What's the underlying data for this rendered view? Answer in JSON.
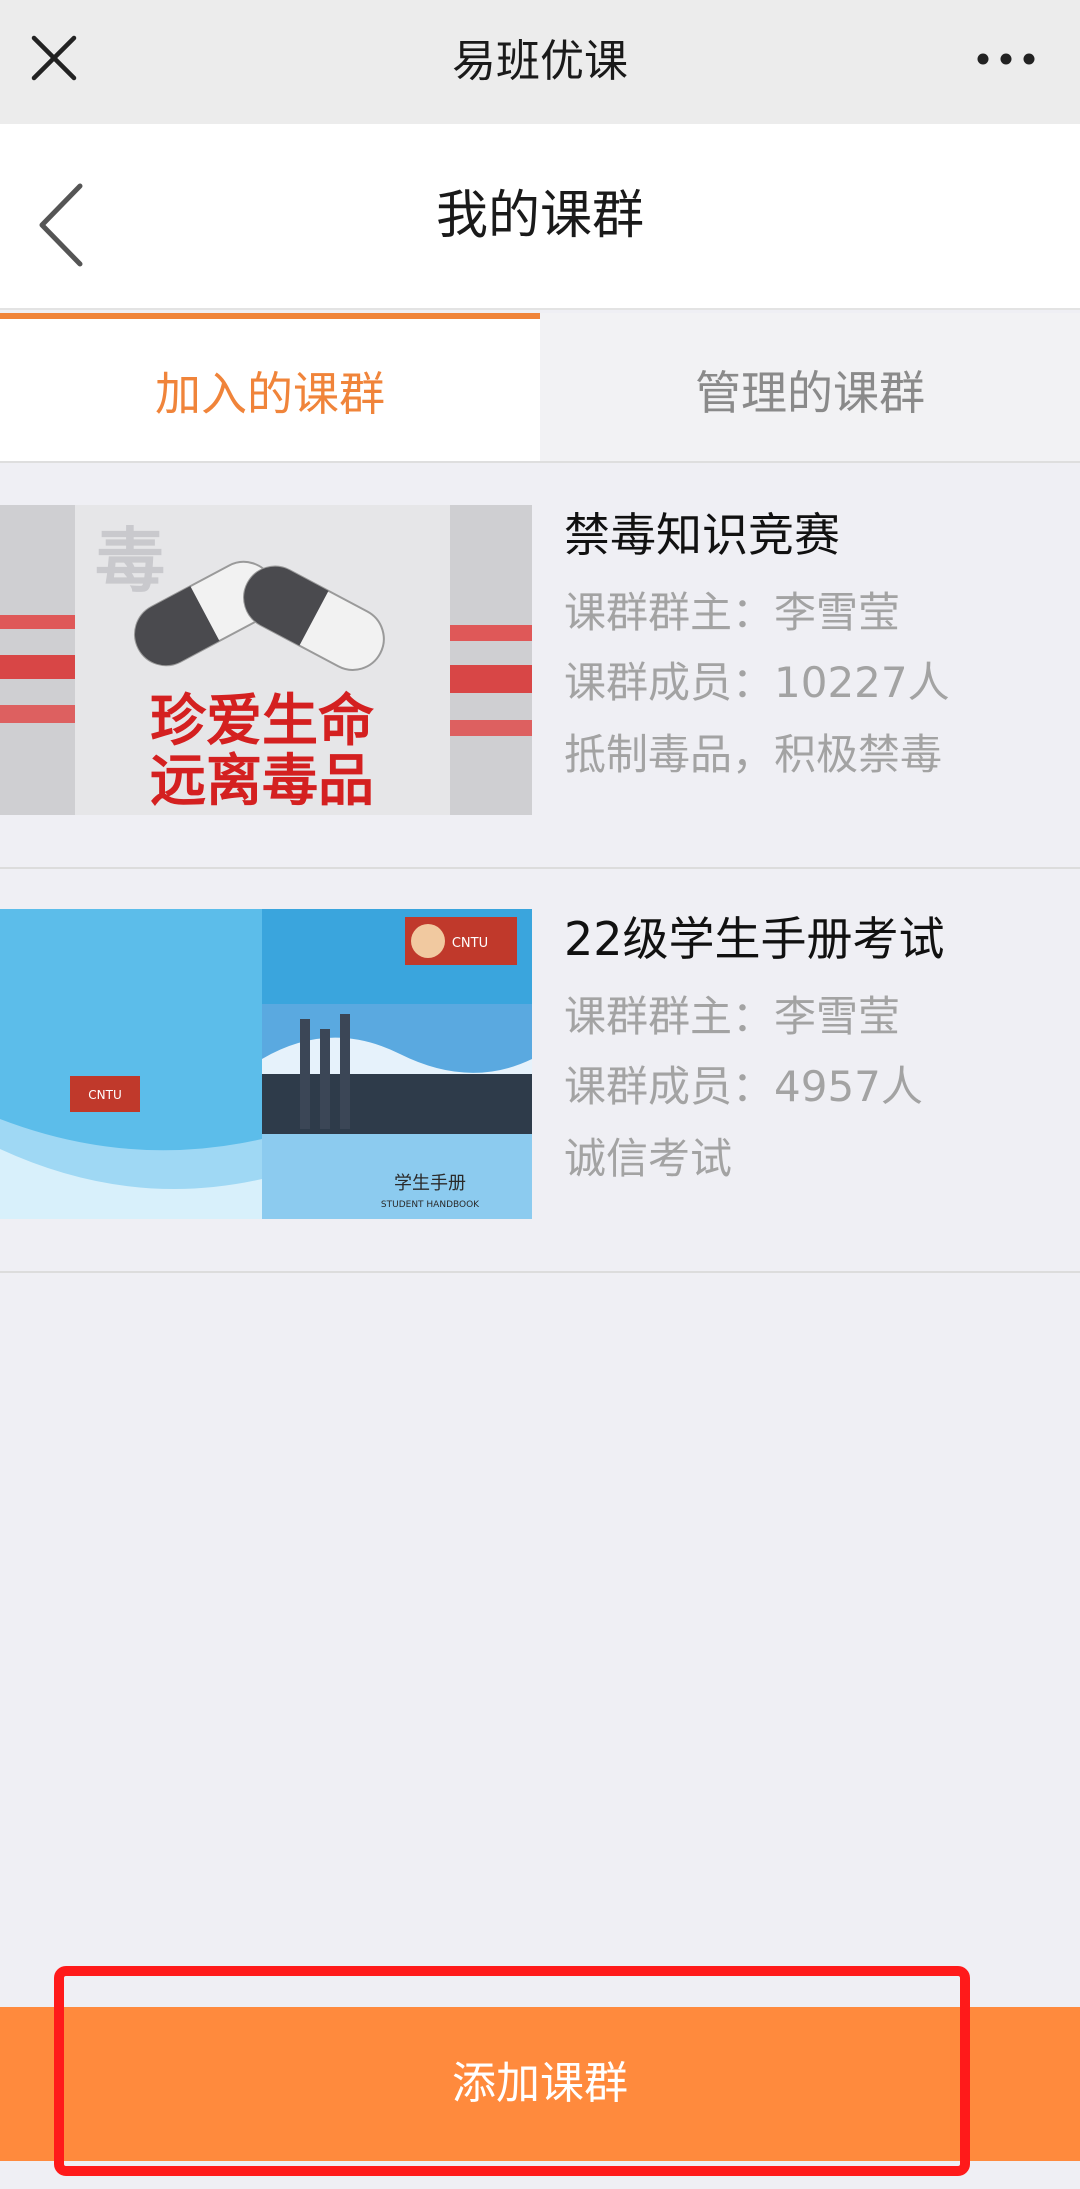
{
  "topbar": {
    "title": "易班优课"
  },
  "header": {
    "title": "我的课群"
  },
  "tabs": [
    {
      "label": "加入的课群",
      "active": true
    },
    {
      "label": "管理的课群",
      "active": false
    }
  ],
  "groups": [
    {
      "name": "禁毒知识竞赛",
      "owner_label": "课群群主：",
      "owner": "李雪莹",
      "members_label": "课群成员：",
      "members": "10227人",
      "description": "抵制毒品，积极禁毒",
      "image_text_line1": "珍爱生命",
      "image_text_line2": "远离毒品"
    },
    {
      "name": "22级学生手册考试",
      "owner_label": "课群群主：",
      "owner": "李雪莹",
      "members_label": "课群成员：",
      "members": "4957人",
      "description": "诚信考试",
      "image_text_cover": "学生手册",
      "image_text_sub": "STUDENT HANDBOOK",
      "image_text_badge": "CNTU"
    }
  ],
  "bottom": {
    "button_label": "添加课群"
  },
  "colors": {
    "accent": "#f0843a",
    "button": "#ff8a3d",
    "highlight": "#ff1a1a"
  }
}
